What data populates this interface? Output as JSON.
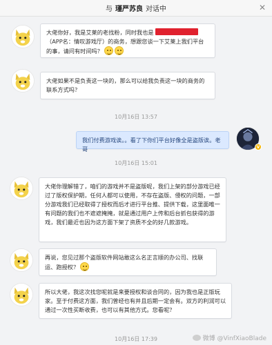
{
  "header": {
    "prefix": "与",
    "contact_name": "瑾严苏良",
    "suffix": "对话中",
    "close_glyph": "✕"
  },
  "messages": [
    {
      "text_before": "大佬你好，我是艾莱的老找粉，同时我也是",
      "text_after": "（APP名：情叹游戏厅）的商务，想跟您谈一下艾莱上我们平台的事，请问有时间吗？"
    },
    {
      "text": "大佬如果不是负责这一块的，那么可以给我负责这一块的商务的联系方式吗？"
    },
    {
      "timestamp": "10月16日 13:57"
    },
    {
      "text": "我们付费游戏诶。。看了下你们平台好像全是盗版诶。老哥"
    },
    {
      "timestamp": "10月16日 15:01"
    },
    {
      "text": "大佬你理解错了，咱们的游戏并不是盗版呢，我们上架的部分游戏已经过了版权保护期，任何人都可以使用，不存在盗版、侵权的问题，一部分游戏我们已经取得了授权而后才进行平台推、提供下载，这里面唯一有问题的我们也不遮遮掩掩，就是通过用户上传和后台抓包获得的游戏，我们最近也因为这方面下架了资质不全的好几款游戏。"
    },
    {
      "text": "再说，您见过那个盗版软件网站敢这么名正言顺的办公司、找联运、跑授权？"
    },
    {
      "text": "所以大佬，我这次找您呢就是来要授权和谈合同的，因为我也是正版玩家。至于付费这方面，我们曾经也有并且后期一定会有。双方的利润可以通过一次性买断收费，也可以有其他方式。您看呢？"
    },
    {
      "timestamp": "10月16日 17:39"
    }
  ],
  "watermark": {
    "text": "微博 @VinfXiaoBlade"
  },
  "colors": {
    "self_bubble": "#dbe9ff",
    "redaction": "#e0212e",
    "badge": "#f5b400"
  }
}
